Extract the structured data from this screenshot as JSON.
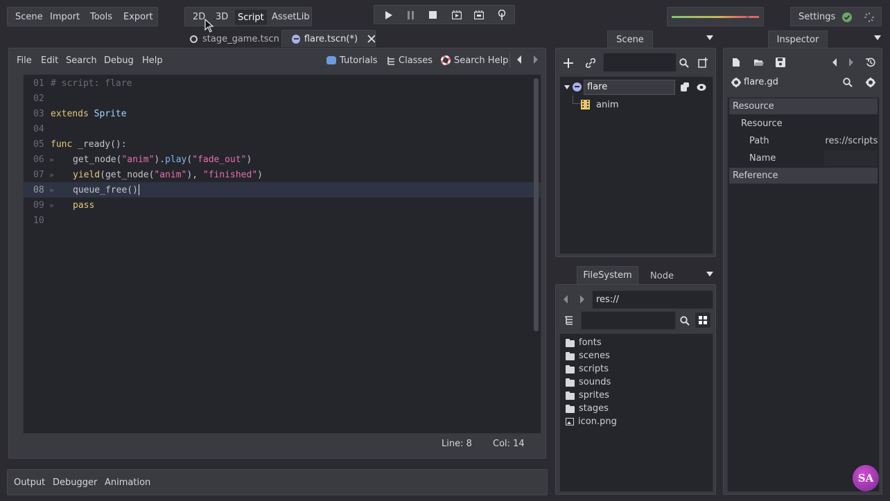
{
  "top_menu": [
    "Scene",
    "Import",
    "Tools",
    "Export"
  ],
  "workspace_tabs": [
    "2D",
    "3D",
    "Script",
    "AssetLib"
  ],
  "active_workspace": "Script",
  "settings_label": "Settings",
  "open_scenes": [
    {
      "label": "stage_game.tscn",
      "icon": "circle-icon"
    },
    {
      "label": "flare.tscn(*)",
      "icon": "node-icon"
    }
  ],
  "script_menu": [
    "File",
    "Edit",
    "Search",
    "Debug",
    "Help"
  ],
  "script_toolbar": {
    "tutorials": "Tutorials",
    "classes": "Classes",
    "search_help": "Search Help"
  },
  "code_lines": [
    {
      "n": "01",
      "text": "# script: flare"
    },
    {
      "n": "02",
      "text": ""
    },
    {
      "n": "03",
      "text": "extends Sprite"
    },
    {
      "n": "04",
      "text": ""
    },
    {
      "n": "05",
      "text": "func _ready():"
    },
    {
      "n": "06",
      "text": "get_node(\"anim\").play(\"fade_out\")"
    },
    {
      "n": "07",
      "text": "yield(get_node(\"anim\"), \"finished\")"
    },
    {
      "n": "08",
      "text": "queue_free()"
    },
    {
      "n": "09",
      "text": "pass"
    },
    {
      "n": "10",
      "text": ""
    }
  ],
  "current_line_index": 7,
  "status": {
    "line": "Line: 8",
    "col": "Col: 14"
  },
  "bottom_tabs": [
    "Output",
    "Debugger",
    "Animation"
  ],
  "scene_dock": {
    "tab": "Scene",
    "search_placeholder": "",
    "nodes": [
      {
        "name": "flare",
        "icon": "node2d-icon",
        "level": 0
      },
      {
        "name": "anim",
        "icon": "animation-player-icon",
        "level": 1
      }
    ]
  },
  "filesystem_dock": {
    "tabs": [
      "FileSystem",
      "Node"
    ],
    "path": "res://",
    "items": [
      {
        "name": "fonts",
        "type": "folder"
      },
      {
        "name": "scenes",
        "type": "folder"
      },
      {
        "name": "scripts",
        "type": "folder"
      },
      {
        "name": "sounds",
        "type": "folder"
      },
      {
        "name": "sprites",
        "type": "folder"
      },
      {
        "name": "stages",
        "type": "folder"
      },
      {
        "name": "icon.png",
        "type": "image"
      }
    ]
  },
  "inspector": {
    "tab": "Inspector",
    "resource_name": "flare.gd",
    "sections": {
      "resource": "Resource",
      "resource_sub": "Resource",
      "reference": "Reference"
    },
    "props": [
      {
        "label": "Path",
        "value": "res://scripts/"
      },
      {
        "label": "Name",
        "value": ""
      }
    ]
  },
  "colors": {
    "background": "#2b2b31",
    "panel": "#3a3b41",
    "editor_bg": "#25262b",
    "accent": "#6ea8f5"
  }
}
